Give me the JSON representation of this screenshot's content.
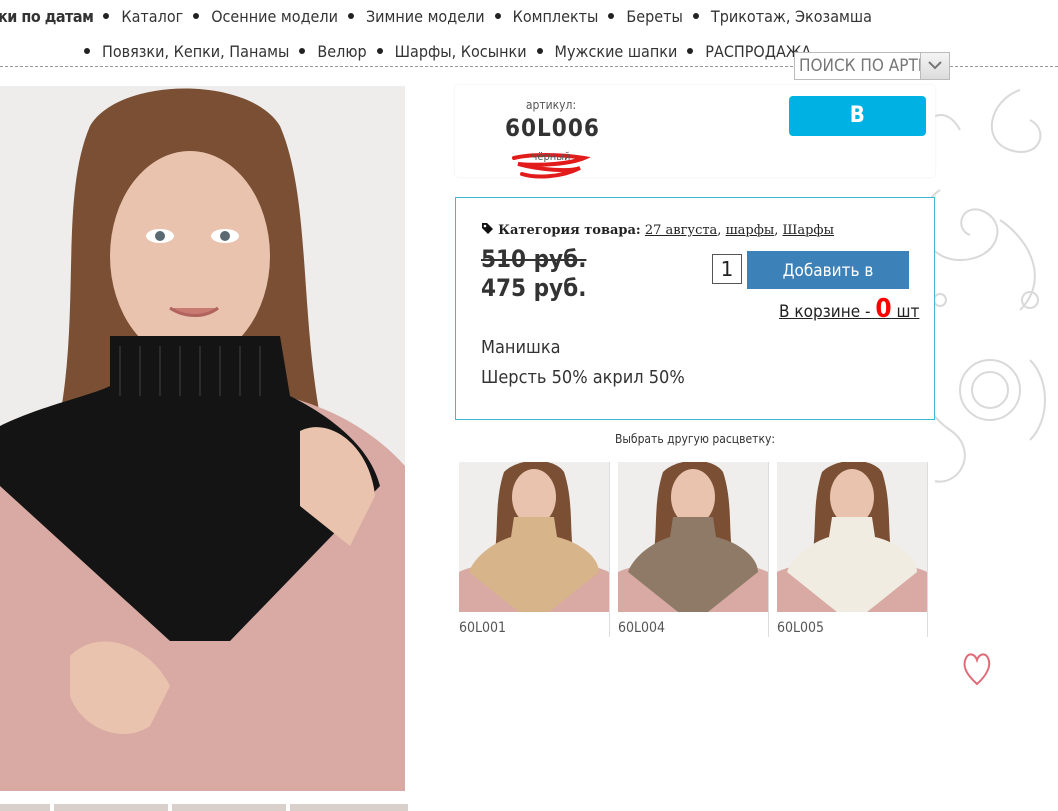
{
  "nav": {
    "row1": [
      "ки по датам",
      "Каталог",
      "Осенние модели",
      "Зимние модели",
      "Комплекты",
      "Береты",
      "Трикотаж, Экозамша"
    ],
    "row2": [
      "Повязки, Кепки, Панамы",
      "Велюр",
      "Шарфы, Косынки",
      "Мужские шапки",
      "РАСПРОДАЖА"
    ]
  },
  "search": {
    "placeholder": "ПОИСК ПО АРТИК"
  },
  "product": {
    "article_label": "артикул:",
    "article": "60L006",
    "color": "чёрный",
    "stock_badge": "В НАЛИЧИИ",
    "category_label": "Категория товара:",
    "categories": [
      "27 августа",
      "шарфы",
      "Шарфы"
    ],
    "old_price": "510 руб.",
    "new_price": "475 руб.",
    "quantity": "1",
    "add_to_cart": "Добавить в корзину",
    "in_cart_prefix": "В корзине - ",
    "in_cart_count": "0",
    "in_cart_suffix": " шт",
    "name": "Манишка",
    "composition": "Шерсть 50% акрил 50%"
  },
  "choose_color_label": "Выбрать другую расцветку:",
  "variants": [
    {
      "code": "60L001",
      "color": "#d8b48a"
    },
    {
      "code": "60L004",
      "color": "#8e7a66"
    },
    {
      "code": "60L005",
      "color": "#f1ece2"
    }
  ],
  "colors": {
    "accent": "#00b2e3",
    "button": "#3c82b8",
    "border": "#3fb7d6",
    "cart_count": "#ff0000"
  }
}
